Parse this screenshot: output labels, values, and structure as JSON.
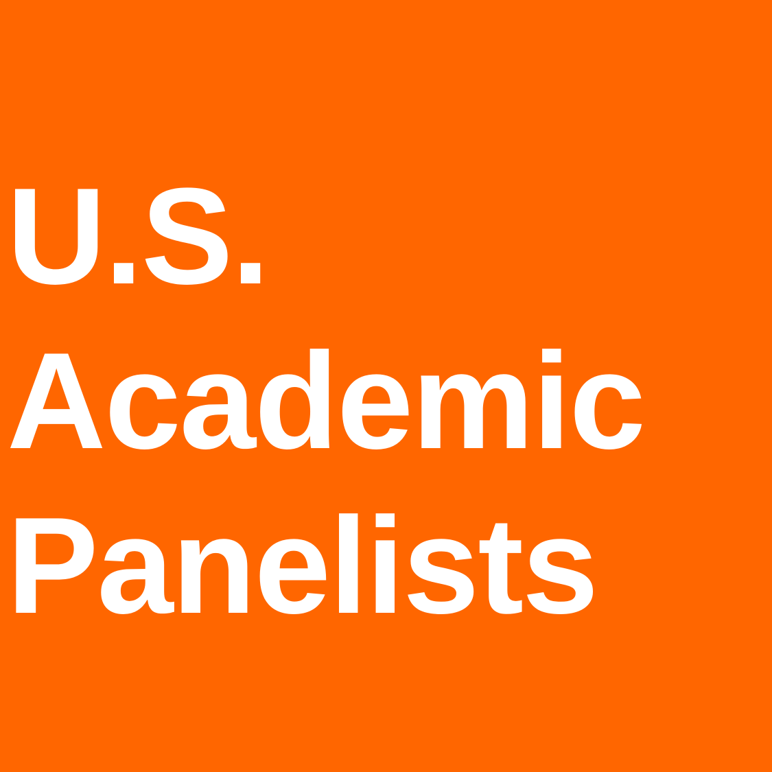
{
  "tile": {
    "background_color": "#FF6600",
    "text_color": "#FFFFFF",
    "title_lines": [
      "U.S.",
      "Academic",
      "Panelists"
    ]
  }
}
